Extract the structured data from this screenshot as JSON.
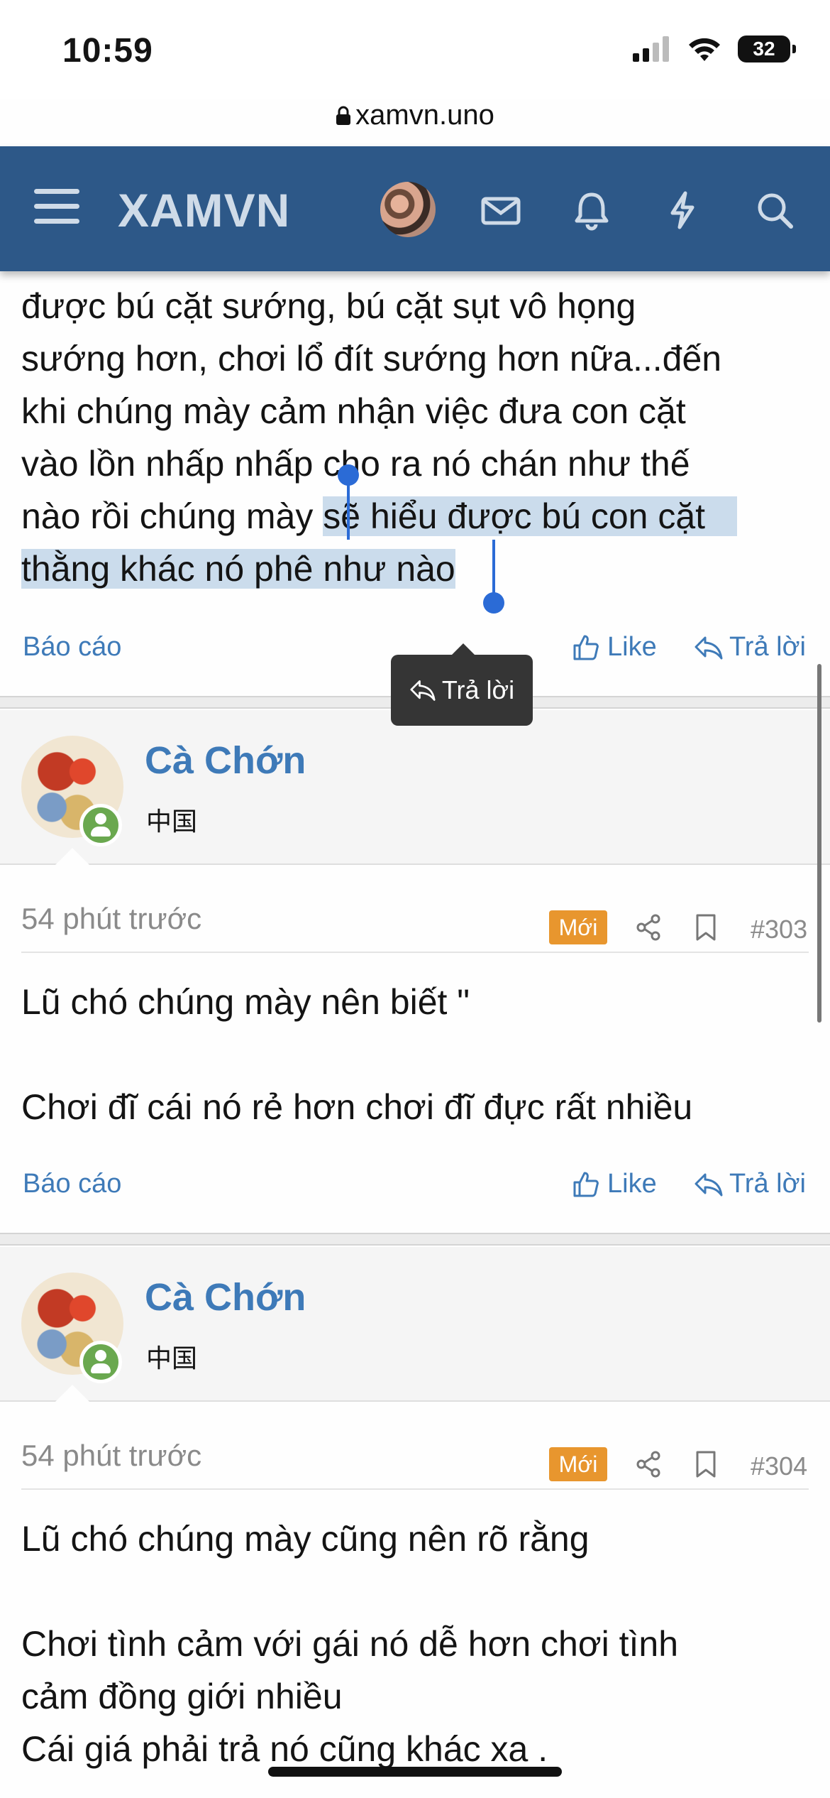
{
  "status": {
    "time": "10:59",
    "battery": "32"
  },
  "browser": {
    "url": "xamvn.uno"
  },
  "header": {
    "logo": "XAMVN"
  },
  "posts": [
    {
      "lines": [
        "được bú cặt sướng, bú cặt sụt vô họng",
        "sướng hơn, chơi lổ đít sướng hơn nữa...đến",
        "khi chúng mày cảm nhận việc đưa con cặt",
        "vào lồn nhấp nhấp cho ra nó chán như thế",
        "nào rồi chúng mày ",
        "sẽ hiểu được bú con cặt",
        "thằng khác nó phê như nào"
      ],
      "report": "Báo cáo",
      "like": "Like",
      "reply": "Trả lời"
    },
    {
      "author": "Cà Chớn",
      "user_title": "中国",
      "time": "54 phút trước",
      "badge": "Mới",
      "number": "#303",
      "lines": [
        "Lũ chó chúng mày nên biết \"",
        "",
        "Chơi đĩ cái nó rẻ hơn chơi đĩ đực rất nhiều"
      ],
      "report": "Báo cáo",
      "like": "Like",
      "reply": "Trả lời"
    },
    {
      "author": "Cà Chớn",
      "user_title": "中国",
      "time": "54 phút trước",
      "badge": "Mới",
      "number": "#304",
      "lines": [
        "Lũ chó chúng mày cũng nên rõ rằng",
        "",
        "Chơi tình cảm với gái nó dễ hơn chơi tình",
        "cảm đồng giới nhiều",
        "Cái giá phải trả nó cũng khác xa ."
      ]
    }
  ],
  "tooltip": {
    "label": "Trả lời"
  }
}
